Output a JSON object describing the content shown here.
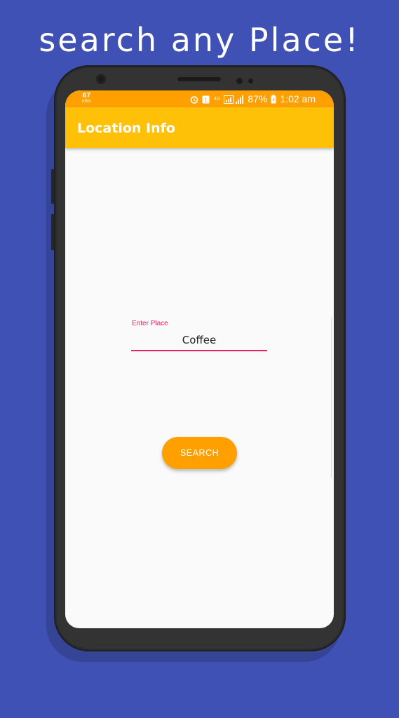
{
  "headline": "search any Place!",
  "statusbar": {
    "speed_value": "67",
    "speed_unit": "KB/s",
    "network_label": "4G",
    "battery": "87%",
    "time": "1:02 am",
    "icons": [
      "alarm-icon",
      "sim-icon",
      "network-icon",
      "signal-icon",
      "battery-icon"
    ]
  },
  "appbar": {
    "title": "Location Info"
  },
  "form": {
    "place_label": "Enter Place",
    "place_value": "Coffee",
    "search_label": "SEARCH"
  },
  "colors": {
    "background": "#3f51b5",
    "status_bar": "#ffa000",
    "app_bar": "#ffc107",
    "accent": "#e91e63",
    "button": "#ffa000"
  }
}
